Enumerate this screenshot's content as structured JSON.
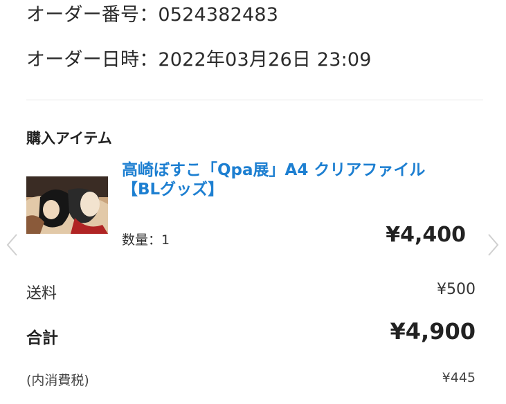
{
  "order": {
    "number_label": "オーダー番号：",
    "number_value": "0524382483",
    "datetime_label": "オーダー日時：",
    "datetime_value": "2022年03月26日 23:09"
  },
  "items_section": {
    "title": "購入アイテム",
    "item": {
      "title_line1": "高崎ぼすこ「Qpa展」A4 クリアファイル",
      "title_line2": "【BLグッズ】",
      "quantity_text": "数量：1",
      "price": "¥4,400",
      "thumbnail_icon": "product-thumbnail-image"
    },
    "carousel": {
      "prev_icon": "chevron-left-icon",
      "next_icon": "chevron-right-icon"
    }
  },
  "summary": {
    "shipping_label": "送料",
    "shipping_value": "¥500",
    "total_label": "合計",
    "total_value": "¥4,900",
    "tax_label": "(内消費税)",
    "tax_value": "¥445"
  },
  "colors": {
    "link": "#1d7fd1",
    "text": "#2b2b2b",
    "divider": "#e6e6e6",
    "arrow": "#d0d0d0"
  }
}
